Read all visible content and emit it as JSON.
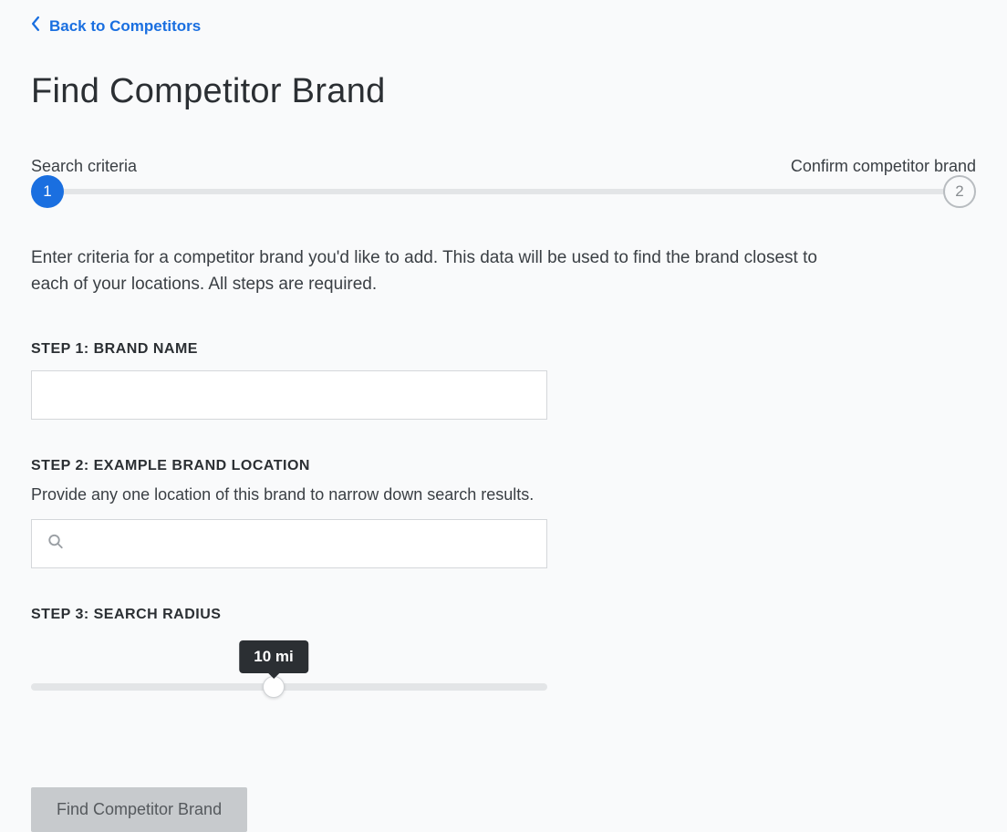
{
  "back_link": {
    "label": "Back to Competitors"
  },
  "page_title": "Find Competitor Brand",
  "stepper": {
    "step1_label": "Search criteria",
    "step2_label": "Confirm competitor brand",
    "step1_num": "1",
    "step2_num": "2"
  },
  "description": "Enter criteria for a competitor brand you'd like to add. This data will be used to find the brand closest to each of your locations. All steps are required.",
  "step1": {
    "heading": "STEP 1: BRAND NAME",
    "value": ""
  },
  "step2": {
    "heading": "STEP 2: EXAMPLE BRAND LOCATION",
    "subtext": "Provide any one location of this brand to narrow down search results.",
    "value": ""
  },
  "step3": {
    "heading": "STEP 3: SEARCH RADIUS",
    "tooltip": "10 mi",
    "percent": 47
  },
  "submit": {
    "label": "Find Competitor Brand"
  }
}
